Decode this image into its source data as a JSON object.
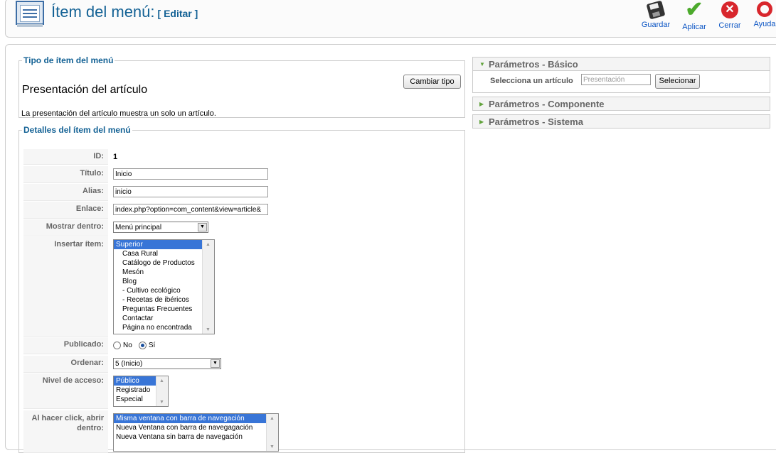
{
  "header": {
    "title": "Ítem del menú:",
    "subtitle": "[ Editar ]",
    "icon": "menu-item-icon"
  },
  "toolbar": {
    "save": "Guardar",
    "apply": "Aplicar",
    "close": "Cerrar",
    "help": "Ayuda"
  },
  "menu_type": {
    "legend": "Tipo de ítem del menú",
    "name": "Presentación del artículo",
    "description": "La presentación del artículo muestra un solo un artículo.",
    "change_button": "Cambiar tipo"
  },
  "details": {
    "legend": "Detalles del ítem del menú",
    "id_label": "ID:",
    "id_value": "1",
    "title_label": "Título:",
    "title_value": "Inicio",
    "alias_label": "Alias:",
    "alias_value": "inicio",
    "link_label": "Enlace:",
    "link_value": "index.php?option=com_content&view=article&",
    "menu_label": "Mostrar dentro:",
    "menu_value": "Menú principal",
    "parent_label": "Insertar ítem:",
    "parent_options": [
      "Superior",
      "Casa Rural",
      "Catálogo de Productos",
      "Mesón",
      "Blog",
      "- Cultivo ecológico",
      "- Recetas de ibéricos",
      "Preguntas Frecuentes",
      "Contactar",
      "Página no encontrada"
    ],
    "published_label": "Publicado:",
    "published_no": "No",
    "published_yes": "Sí",
    "published_value": "Sí",
    "order_label": "Ordenar:",
    "order_value": "5 (Inicio)",
    "access_label": "Nivel de acceso:",
    "access_options": [
      "Público",
      "Registrado",
      "Especial"
    ],
    "browser_nav_label": "Al hacer click, abrir dentro:",
    "browser_nav_options": [
      "Misma ventana con barra de navegación",
      "Nueva Ventana con barra de navegagación",
      "Nueva Ventana sin barra de navegación"
    ]
  },
  "params": {
    "basic_title": "Parámetros - Básico",
    "article_label": "Selecciona un artículo",
    "article_placeholder": "Presentación",
    "select_button": "Selecionar",
    "component_title": "Parámetros - Componente",
    "system_title": "Parámetros - Sistema"
  },
  "colors": {
    "title_blue": "#146295",
    "link_blue": "#0b55c4",
    "selection": "#3875d7",
    "close_red": "#d8262c",
    "apply_green": "#4caa2c"
  }
}
